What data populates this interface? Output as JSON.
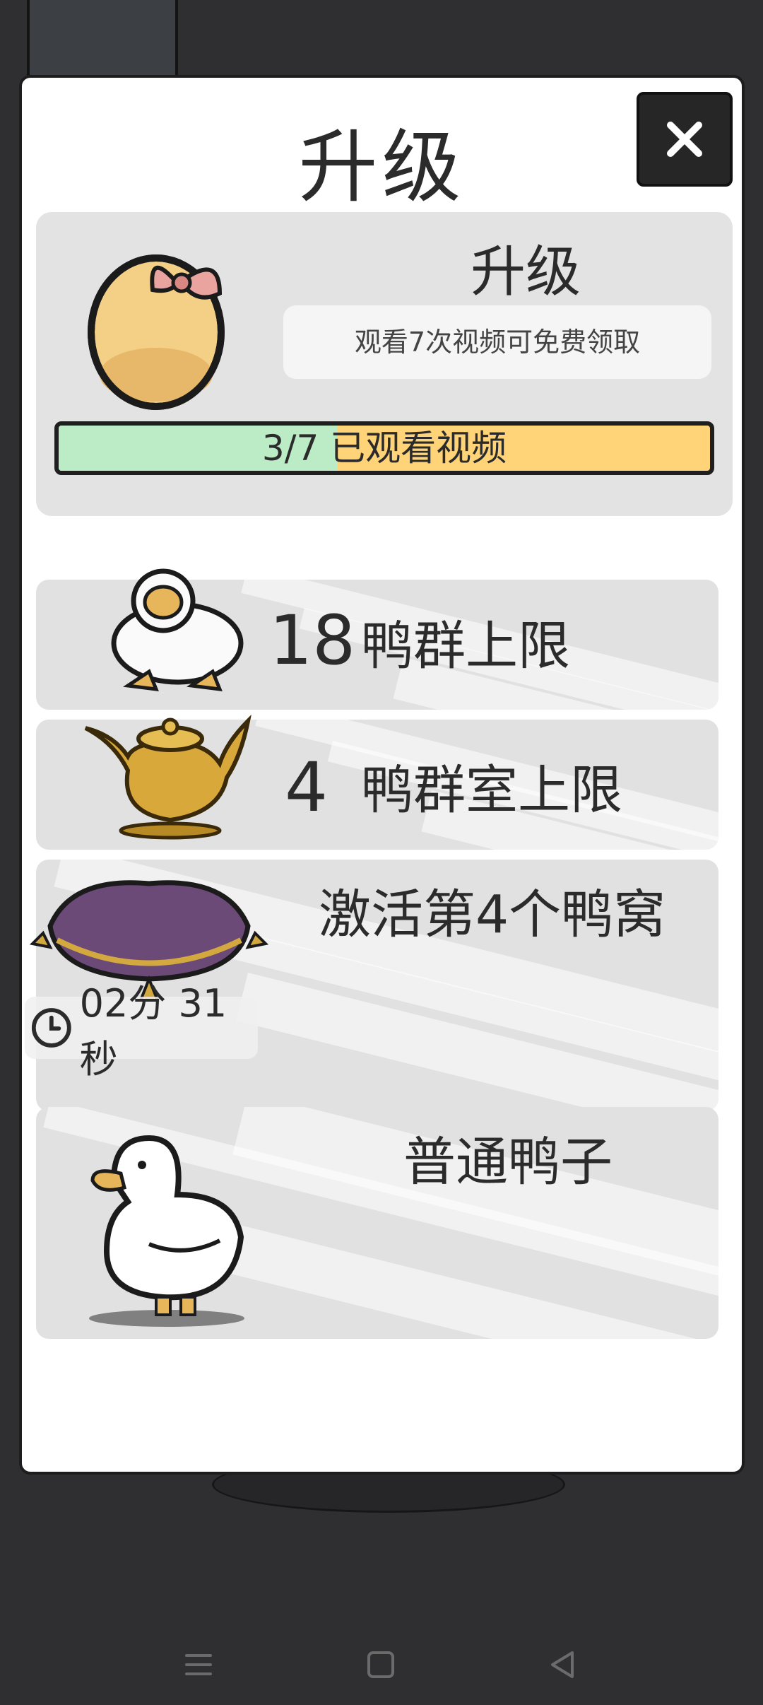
{
  "dialog": {
    "title": "升级",
    "close_icon": "close-icon"
  },
  "upgrade_card": {
    "title": "升级",
    "note": "观看7次视频可免费领取",
    "progress": {
      "label": "3/7 已观看视频",
      "watched": 3,
      "total": 7
    },
    "colors": {
      "progress_done": "#bcecc5",
      "progress_remaining": "#ffd479"
    }
  },
  "perks": [
    {
      "value": "18",
      "label": "鸭群上限",
      "icon": "running-duck-icon"
    },
    {
      "value": "4",
      "label": "鸭群室上限",
      "icon": "golden-teapot-icon"
    },
    {
      "label": "激活第4个鸭窝",
      "icon": "purple-cushion-icon",
      "timer": "02分 31秒",
      "timer_icon": "clock-icon"
    },
    {
      "label": "普通鸭子",
      "icon": "white-duck-icon"
    }
  ],
  "navbar": {
    "icons": [
      "menu-icon",
      "home-square-icon",
      "back-triangle-icon"
    ]
  }
}
